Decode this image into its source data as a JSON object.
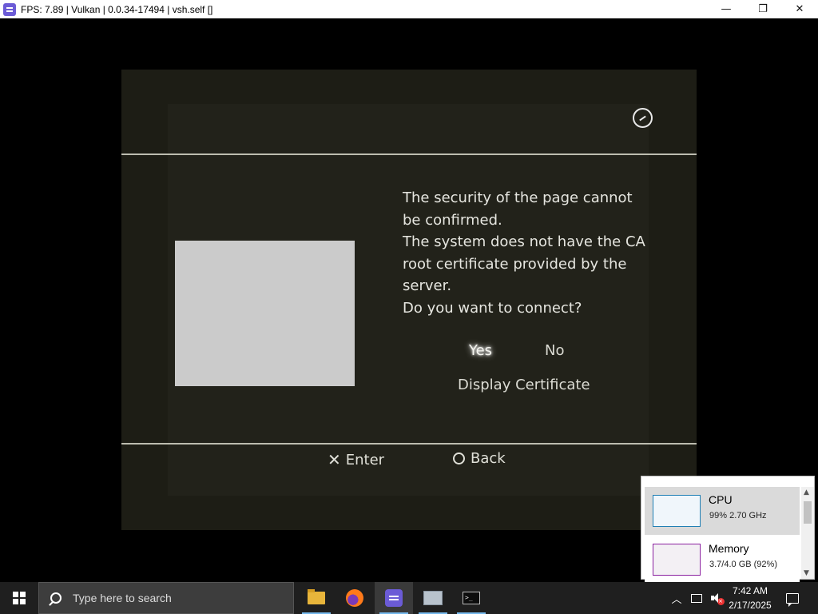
{
  "window": {
    "title": "FPS: 7.89 | Vulkan | 0.0.34-17494 | vsh.self []",
    "controls": {
      "minimize": "—",
      "maximize": "❐",
      "close": "✕"
    }
  },
  "dialog": {
    "message_lines": [
      "The security of the page cannot",
      "be confirmed.",
      "The system does not have the CA",
      "root certificate provided by the",
      "server.",
      "Do you want to connect?"
    ],
    "options": {
      "yes": "Yes",
      "no": "No",
      "display_certificate": "Display Certificate"
    },
    "selected_option": "yes",
    "hints": {
      "enter": "Enter",
      "back": "Back",
      "enter_symbol": "✕"
    }
  },
  "task_manager": {
    "cpu": {
      "name": "CPU",
      "value": "99%  2.70 GHz"
    },
    "memory": {
      "name": "Memory",
      "value": "3.7/4.0 GB (92%)"
    }
  },
  "taskbar": {
    "search_placeholder": "Type here to search",
    "apps": [
      "file-explorer-icon",
      "firefox-icon",
      "rpcs3-icon",
      "network-icon",
      "terminal-icon"
    ],
    "tray_chevron": "︿",
    "clock": {
      "time": "7:42 AM",
      "date": "2/17/2025"
    }
  },
  "colors": {
    "accent": "#6b5bd6",
    "dialog_bg": "#1d1d15",
    "cpu_graph": "#1f7fb5",
    "memory_graph": "#8b22a0"
  }
}
